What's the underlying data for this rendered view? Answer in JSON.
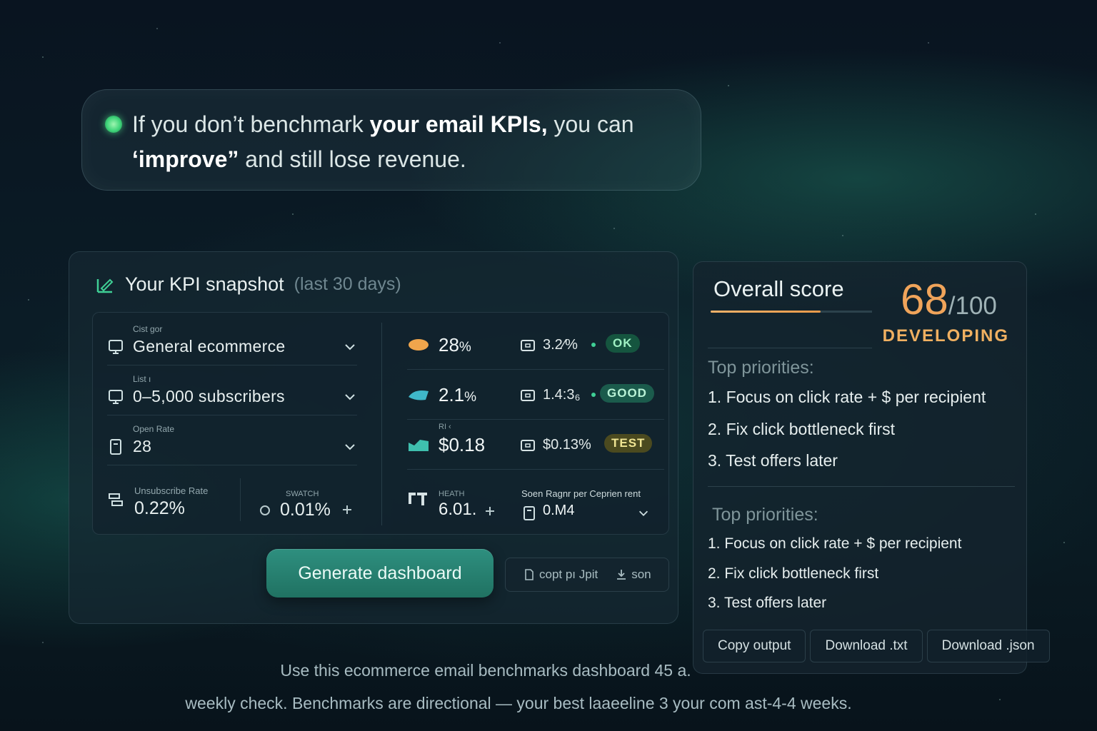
{
  "headline": {
    "part1": "If you don’t benchmark ",
    "bold": "your email KPIs,",
    "part2": " you can",
    "line2_bold": "‘improve”",
    "line2_rest": " and still lose revenue."
  },
  "snapshot": {
    "title": "Your KPI snapshot",
    "subtitle": "(last 30 days)",
    "fields": [
      {
        "label": "Cist gor",
        "value": "General ecommerce"
      },
      {
        "label": "List ı",
        "value": "0–5,000 subscribers"
      },
      {
        "label": "Open Rate",
        "value": "28"
      }
    ],
    "unsub": {
      "label": "Unsubscribe Rate",
      "value": "0.22%"
    },
    "swatch": {
      "label": "SWATCH",
      "value": "0.01%"
    },
    "metrics": [
      {
        "value": "28",
        "unit": "%",
        "compare": "3.2⁄%",
        "badge": "OK",
        "shape_color": "#f0a54c"
      },
      {
        "value": "2.1",
        "unit": "%",
        "compare": "1.4:3₆",
        "badge": "GOOD",
        "shape_color": "#3fb7c9"
      },
      {
        "tiny": "RI   ‹",
        "value": "$0.18",
        "unit": "",
        "compare": "$0.13%",
        "badge": "TEST",
        "shape_color": "#3fbfae"
      }
    ],
    "heath": {
      "label": "HEATH",
      "value": "6.01."
    },
    "rev_per_recipient": {
      "label": "Soen Ragnr per Ceprien rent",
      "value": "0.M4"
    },
    "generate_label": "Generate dashboard",
    "export": {
      "copy_label": "copt pı Jpit",
      "json_label": "son"
    }
  },
  "score": {
    "title": "Overall score",
    "value": "68",
    "max": "/100",
    "progress": 0.68,
    "status": "DEVELOPING",
    "priorities_a_title": "Top priorities:",
    "priorities_a": [
      "1.  Focus on click rate + $ per recipient",
      "2. Fix click bottleneck first",
      "3. Test offers later"
    ],
    "priorities_b_title": "Top priorities:",
    "priorities_b": [
      "1. Focus on click rate + $ per recipient",
      "2. Fix click bottleneck first",
      "3. Test offers later"
    ],
    "actions": {
      "copy": "Copy output",
      "txt": "Download .txt",
      "json": "Download .json"
    }
  },
  "footer": {
    "line1": "Use this ecommerce email benchmarks dashboard 45 a.",
    "line2": "weekly check. Benchmarks are directional — your best laaeeline 3 your com ast-4-4 weeks."
  },
  "colors": {
    "accent": "#2e8f7f",
    "score": "#f0a45a",
    "ok": "#15553f",
    "test": "#4b4a1f"
  }
}
